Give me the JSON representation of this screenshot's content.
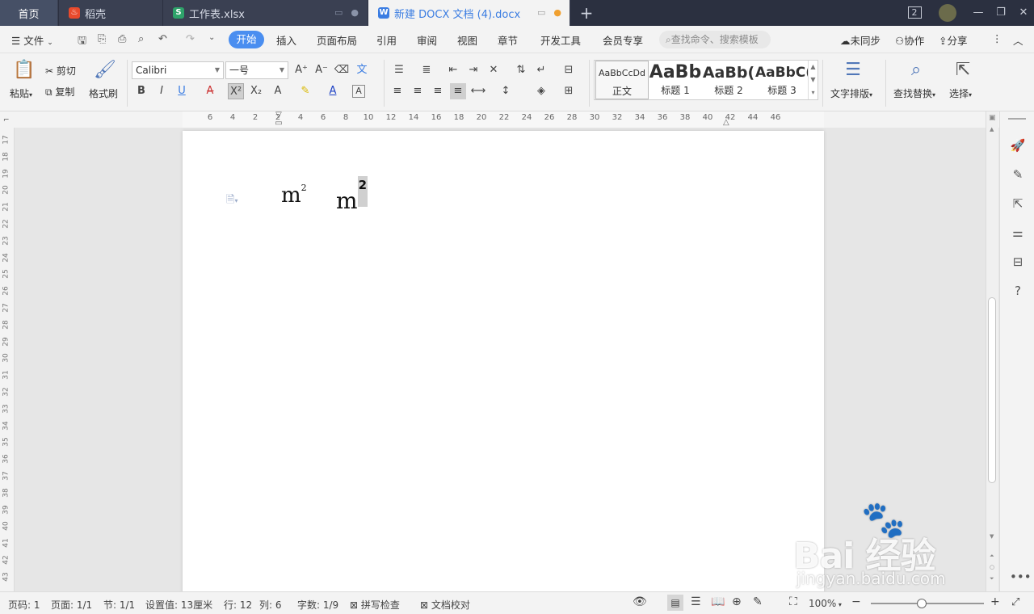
{
  "tabs": {
    "home": "首页",
    "t1": "稻壳",
    "t2": "工作表.xlsx",
    "t3": "新建 DOCX 文档 (4).docx",
    "new_tab": "+",
    "window_count": "2"
  },
  "menu": {
    "file": "文件",
    "items": [
      "开始",
      "插入",
      "页面布局",
      "引用",
      "审阅",
      "视图",
      "章节",
      "开发工具",
      "会员专享"
    ],
    "search_placeholder": "查找命令、搜索模板",
    "sync": "未同步",
    "collab": "协作",
    "share": "分享"
  },
  "ribbon": {
    "paste": "粘贴",
    "cut": "剪切",
    "copy": "复制",
    "format_painter": "格式刷",
    "font_name": "Calibri",
    "font_size": "一号",
    "styles": [
      {
        "preview": "AaBbCcDd",
        "label": "正文"
      },
      {
        "preview": "AaBb",
        "label": "标题 1"
      },
      {
        "preview": "AaBb(",
        "label": "标题 2"
      },
      {
        "preview": "AaBbC(",
        "label": "标题 3"
      }
    ],
    "text_layout": "文字排版",
    "find_replace": "查找替换",
    "select": "选择"
  },
  "ruler": {
    "h_numbers": [
      "6",
      "4",
      "2",
      "2",
      "4",
      "6",
      "8",
      "10",
      "12",
      "14",
      "16",
      "18",
      "20",
      "22",
      "24",
      "26",
      "28",
      "30",
      "32",
      "34",
      "36",
      "38",
      "40",
      "42",
      "44",
      "46"
    ],
    "v_numbers": [
      "17",
      "18",
      "19",
      "20",
      "21",
      "22",
      "23",
      "24",
      "25",
      "26",
      "27",
      "28",
      "29",
      "30",
      "31",
      "32",
      "33",
      "34",
      "35",
      "36",
      "37",
      "38",
      "39",
      "40",
      "41",
      "42",
      "43"
    ]
  },
  "document": {
    "text1_base": "m",
    "text1_sup": "2",
    "text2_base": "m",
    "text2_sup": "2"
  },
  "status": {
    "page": "页码: 1",
    "pages": "页面: 1/1",
    "section": "节: 1/1",
    "setting": "设置值: 13厘米",
    "row": "行: 12",
    "col": "列: 6",
    "words": "字数: 1/9",
    "spell": "拼写检查",
    "proof": "文档校对",
    "zoom": "100%",
    "zoom_level": 0.45
  },
  "watermark": {
    "logo": "Bai 经验",
    "url": "jingyan.baidu.com"
  }
}
